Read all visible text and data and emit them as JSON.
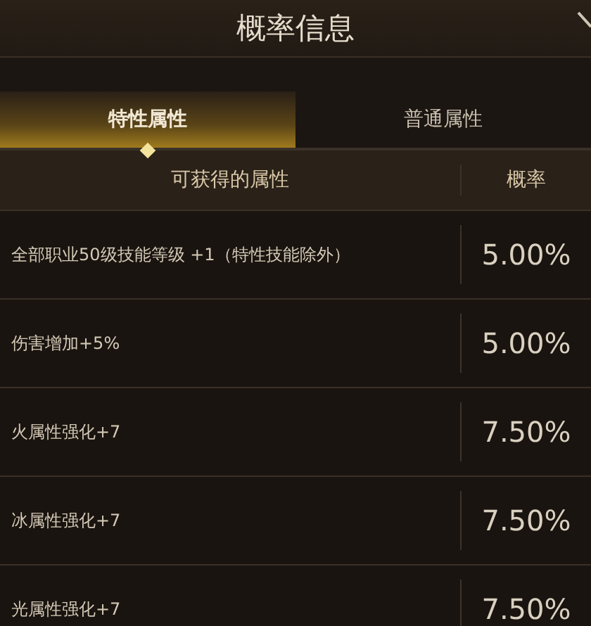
{
  "window": {
    "title": "概率信息"
  },
  "tabs": [
    {
      "label": "特性属性",
      "selected": true
    },
    {
      "label": "普通属性",
      "selected": false
    }
  ],
  "table": {
    "columns": [
      "可获得的属性",
      "概率"
    ],
    "rows": [
      {
        "attribute": "全部职业50级技能等级 +1（特性技能除外）",
        "rate": "5.00%"
      },
      {
        "attribute": "伤害增加+5%",
        "rate": "5.00%"
      },
      {
        "attribute": "火属性强化+7",
        "rate": "7.50%"
      },
      {
        "attribute": "冰属性强化+7",
        "rate": "7.50%"
      },
      {
        "attribute": "光属性强化+7",
        "rate": "7.50%"
      }
    ]
  }
}
